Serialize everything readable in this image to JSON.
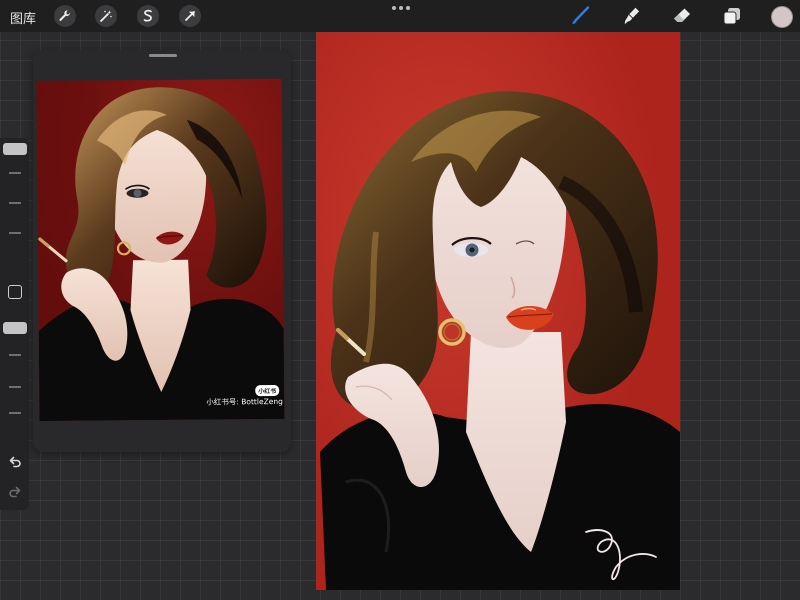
{
  "topbar": {
    "gallery_label": "图库",
    "left_tools": [
      "wrench-icon",
      "magic-wand-icon",
      "selection-icon",
      "transform-arrow-icon"
    ],
    "right_tools": [
      "brush-icon",
      "smudge-icon",
      "eraser-icon",
      "layers-icon"
    ],
    "active_tool": "brush-icon",
    "active_color": "#d3c6c7",
    "accent": "#2f7de1"
  },
  "sidebar": {
    "controls": [
      "brush-size-slider",
      "modify-button",
      "opacity-slider",
      "undo-icon",
      "redo-icon"
    ]
  },
  "reference": {
    "watermark_text": "小红书号: BottleZeng",
    "badge_text": "小红书"
  },
  "canvas": {
    "background_color": "#b22820"
  }
}
